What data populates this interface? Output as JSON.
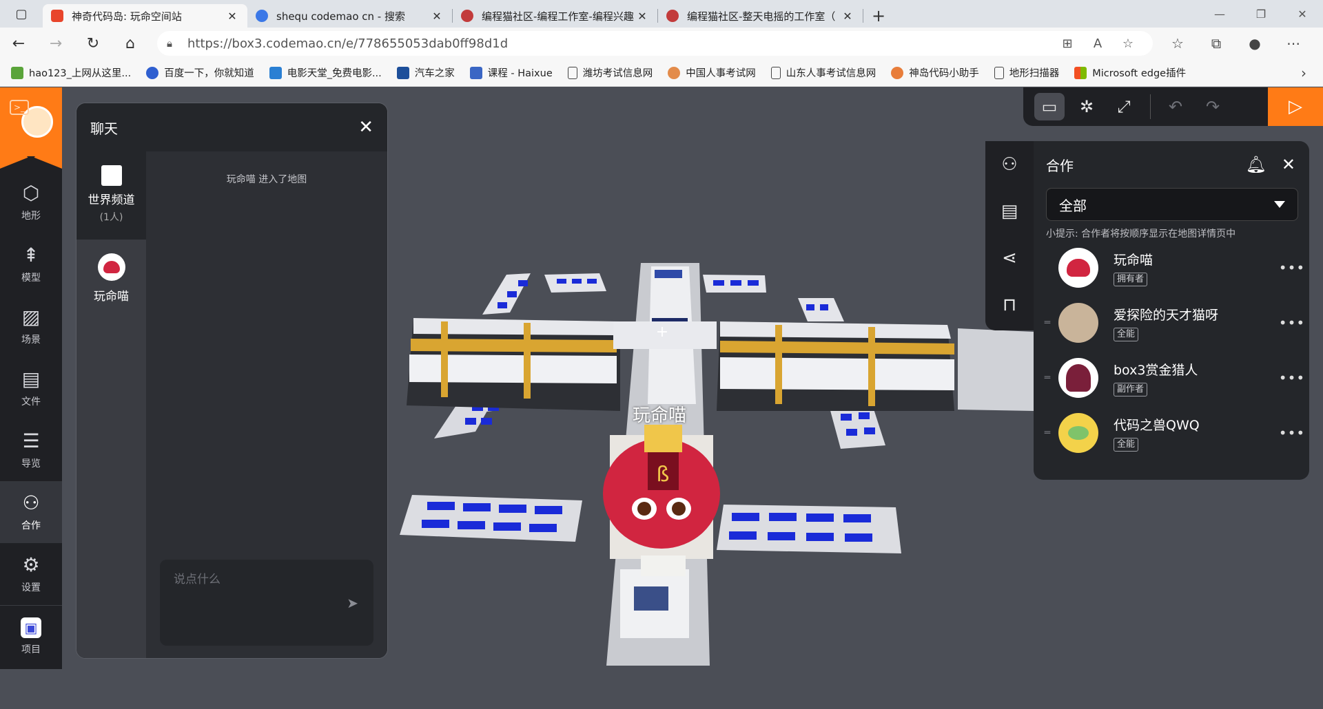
{
  "browser": {
    "tabs": [
      {
        "title": "神奇代码岛: 玩命空间站",
        "favicon_color": "#e8452b",
        "active": true
      },
      {
        "title": "shequ codemao cn - 搜索",
        "favicon_color": "#3b78e7",
        "active": false
      },
      {
        "title": "编程猫社区-编程工作室-编程兴趣",
        "favicon_color": "#c23b3b",
        "active": false
      },
      {
        "title": "编程猫社区-整天电摇的工作室（",
        "favicon_color": "#c23b3b",
        "active": false
      }
    ],
    "new_tab": "+",
    "url": "https://box3.codemao.cn/e/778655053dab0ff98d1d",
    "bookmarks": [
      {
        "label": "hao123_上网从这里...",
        "color": "#5aa43a"
      },
      {
        "label": "百度一下，你就知道",
        "color": "#2f5fd0"
      },
      {
        "label": "电影天堂_免费电影...",
        "color": "#2a7fd3"
      },
      {
        "label": "汽车之家",
        "color": "#1d4f9a"
      },
      {
        "label": "课程 - Haixue",
        "color": "#3a66c4"
      },
      {
        "label": "潍坊考试信息网",
        "color": "#ffffff"
      },
      {
        "label": "中国人事考试网",
        "color": "#e38b4a"
      },
      {
        "label": "山东人事考试信息网",
        "color": "#ffffff"
      },
      {
        "label": "神岛代码小助手",
        "color": "#e87d3a"
      },
      {
        "label": "地形扫描器",
        "color": "#ffffff"
      },
      {
        "label": "Microsoft edge插件",
        "color": "#f25022"
      }
    ]
  },
  "sidebar": {
    "items": [
      {
        "label": "地形",
        "icon": "cube-icon",
        "glyph": "⬡"
      },
      {
        "label": "模型",
        "icon": "tree-icon",
        "glyph": "⇞"
      },
      {
        "label": "场景",
        "icon": "image-icon",
        "glyph": "▨"
      },
      {
        "label": "文件",
        "icon": "folder-icon",
        "glyph": "▤"
      },
      {
        "label": "导览",
        "icon": "list-icon",
        "glyph": "☰"
      },
      {
        "label": "合作",
        "icon": "users-icon",
        "glyph": "⚇"
      },
      {
        "label": "设置",
        "icon": "gear-icon",
        "glyph": "⚙"
      },
      {
        "label": "项目",
        "icon": "project-icon",
        "glyph": "▣"
      }
    ]
  },
  "chat": {
    "title": "聊天",
    "channel": {
      "name": "世界频道",
      "count": "(1人)"
    },
    "dm": {
      "name": "玩命喵"
    },
    "system_message": "玩命喵 进入了地图",
    "input_placeholder": "说点什么"
  },
  "scene": {
    "player_name": "玩命喵"
  },
  "coop": {
    "title": "合作",
    "filter": "全部",
    "tip": "小提示: 合作者将按顺序显示在地图详情页中",
    "members": [
      {
        "name": "玩命喵",
        "role": "拥有者",
        "avatar_color": "#d12540"
      },
      {
        "name": "爱探险的天才猫呀",
        "role": "全能",
        "avatar_color": "#c9b49a"
      },
      {
        "name": "box3赏金猎人",
        "role": "副作者",
        "avatar_color": "#7a1f3a"
      },
      {
        "name": "代码之兽QWQ",
        "role": "全能",
        "avatar_color": "#f3d24a"
      }
    ]
  }
}
